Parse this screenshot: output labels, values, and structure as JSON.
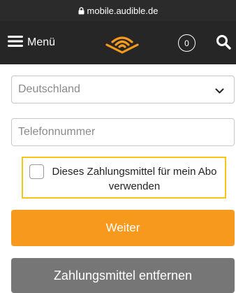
{
  "browser": {
    "url": "mobile.audible.de"
  },
  "header": {
    "menu_label": "Menü",
    "cart_count": "0"
  },
  "form": {
    "country_select": {
      "value": "Deutschland"
    },
    "phone_field": {
      "placeholder": "Telefonnummer",
      "value": ""
    },
    "use_for_subscription": {
      "label": "Dieses Zahlungsmittel für mein Abo verwenden",
      "checked": false
    }
  },
  "buttons": {
    "continue_label": "Weiter",
    "remove_label": "Zahlungsmittel entfernen"
  },
  "colors": {
    "accent_orange": "#f7991c",
    "checkbox_highlight": "#f5c518",
    "header_bg": "#262626",
    "remove_button_bg": "#767676"
  }
}
